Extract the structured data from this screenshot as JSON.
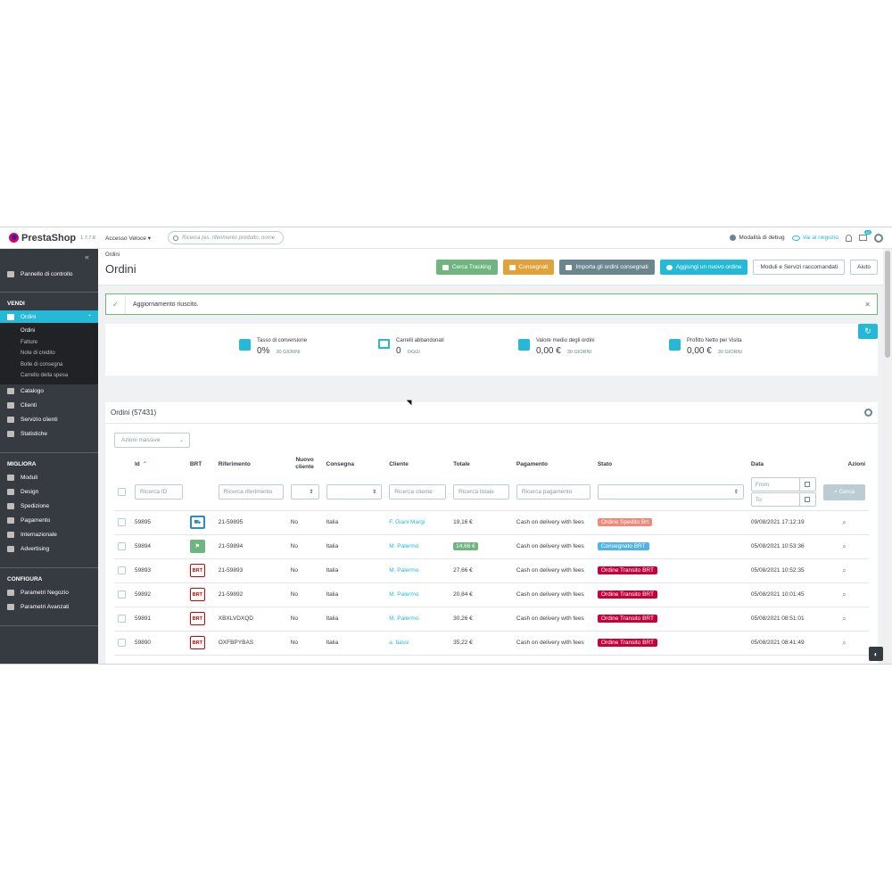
{
  "header": {
    "logo": "PrestaShop",
    "version": "1.7.7.8",
    "quick_access": "Accesso Veloce",
    "search_placeholder": "Ricerca (es. riferimento prodotto, nome",
    "debug": "Modalità di debug",
    "shop_link": "Vai al negozio",
    "cart_badge": "10"
  },
  "sidebar": {
    "dashboard": "Pannello di controllo",
    "sections": {
      "vendi": "VENDI",
      "migliora": "MIGLIORA",
      "configura": "CONFIGURA"
    },
    "orders": "Ordini",
    "orders_sub": [
      "Ordini",
      "Fatture",
      "Note di credito",
      "Bolle di consegna",
      "Carrello della spesa"
    ],
    "vendi_items": [
      "Catalogo",
      "Clienti",
      "Servizio clienti",
      "Statistiche"
    ],
    "migliora_items": [
      "Moduli",
      "Design",
      "Spedizione",
      "Pagamento",
      "Internazionale",
      "Advertising"
    ],
    "configura_items": [
      "Parametri Negozio",
      "Parametri Avanzati"
    ]
  },
  "page": {
    "breadcrumb": "Ordini",
    "title": "Ordini",
    "buttons": {
      "tracking": "Cerca Tracking",
      "delivered": "Consegnati",
      "import": "Importa gli ordini consegnati",
      "add": "Aggiungi un nuovo ordine",
      "modules": "Moduli e Servizi raccomandati",
      "help": "Aiuto"
    }
  },
  "alert": {
    "message": "Aggiornamento riuscito."
  },
  "kpis": [
    {
      "label": "Tasso di conversione",
      "value": "0%",
      "period": "30 GIORNI"
    },
    {
      "label": "Carrelli abbandonati",
      "value": "0",
      "period": "OGGI"
    },
    {
      "label": "Valore medio degli ordini",
      "value": "0,00 €",
      "period": "30 GIORNI"
    },
    {
      "label": "Profitto Netto per Visita",
      "value": "0,00 €",
      "period": "30 GIORNI"
    }
  ],
  "orders_card": {
    "title": "Ordini (57431)",
    "bulk_actions": "Azioni massive",
    "columns": {
      "id": "Id",
      "brt": "BRT",
      "ref": "Riferimento",
      "new_client": "Nuovo cliente",
      "delivery": "Consegna",
      "client": "Cliente",
      "total": "Totale",
      "payment": "Pagamento",
      "status": "Stato",
      "date": "Data",
      "actions": "Azioni"
    },
    "filters": {
      "id": "Ricerca ID",
      "ref": "Ricerca riferimento",
      "client": "Ricerca cliente",
      "total": "Ricerca totale",
      "payment": "Ricerca pagamento",
      "from": "From",
      "to": "To",
      "search_button": "Cerca"
    },
    "rows": [
      {
        "id": "59895",
        "brt": "truck",
        "ref": "21-59895",
        "new": "No",
        "delivery": "Italia",
        "client": "F. Giani Margi",
        "total": "19,16 €",
        "total_badge": false,
        "payment": "Cash on delivery with fees",
        "status": "Ordine Spedito Brt",
        "status_color": "#f0897a",
        "date": "09/08/2021 17:12:19"
      },
      {
        "id": "59894",
        "brt": "flag",
        "ref": "21-59894",
        "new": "No",
        "delivery": "Italia",
        "client": "M. Palermo",
        "total": "14,66 €",
        "total_badge": true,
        "payment": "Cash on delivery with fees",
        "status": "Consegnato BRT",
        "status_color": "#4fb3e8",
        "date": "05/08/2021 10:53:36"
      },
      {
        "id": "59893",
        "brt": "red",
        "ref": "21-59893",
        "new": "No",
        "delivery": "Italia",
        "client": "M. Palermo",
        "total": "27,66 €",
        "total_badge": false,
        "payment": "Cash on delivery with fees",
        "status": "Ordine Transito BRT",
        "status_color": "#c8003a",
        "date": "05/08/2021 10:52:35"
      },
      {
        "id": "59892",
        "brt": "red",
        "ref": "21-59892",
        "new": "No",
        "delivery": "Italia",
        "client": "M. Palermo",
        "total": "20,84 €",
        "total_badge": false,
        "payment": "Cash on delivery with fees",
        "status": "Ordine Transito BRT",
        "status_color": "#c8003a",
        "date": "05/08/2021 10:01:45"
      },
      {
        "id": "59891",
        "brt": "red",
        "ref": "XBXLVDXQD",
        "new": "No",
        "delivery": "Italia",
        "client": "M. Palermo",
        "total": "30,26 €",
        "total_badge": false,
        "payment": "Cash on delivery with fees",
        "status": "Ordine Transito BRT",
        "status_color": "#c8003a",
        "date": "05/08/2021 08:51:01"
      },
      {
        "id": "59890",
        "brt": "red",
        "ref": "OXFBPYBAS",
        "new": "No",
        "delivery": "Italia",
        "client": "a. bassi",
        "total": "35,22 €",
        "total_badge": false,
        "payment": "Cash on delivery with fees",
        "status": "Ordine Transito BRT",
        "status_color": "#c8003a",
        "date": "05/08/2021 08:41:49"
      }
    ]
  }
}
